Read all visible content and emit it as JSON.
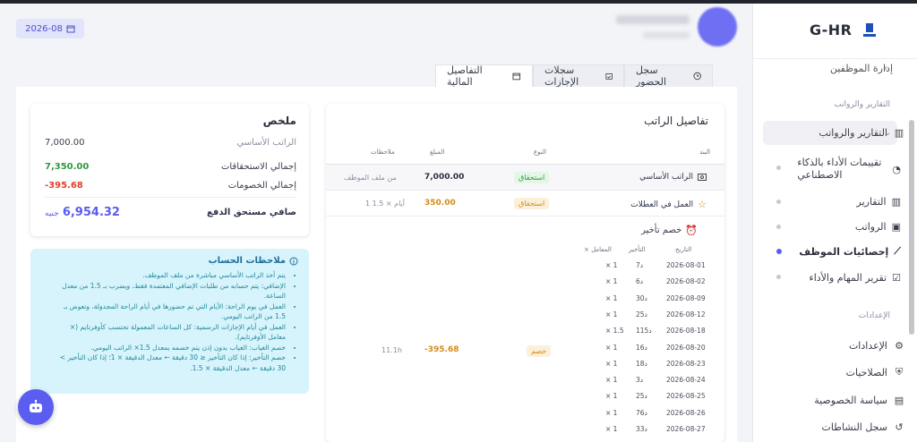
{
  "header": {
    "date_chip": "2026-08"
  },
  "brand": {
    "name": "G-HR"
  },
  "tabs": [
    {
      "label": "سجل الحضور",
      "icon": "clock-icon"
    },
    {
      "label": "سجلات الإجازات",
      "icon": "calendar-icon"
    },
    {
      "label": "التفاصيل المالية",
      "icon": "wallet-icon",
      "active": true
    }
  ],
  "sidebar": {
    "partial_top": "إدارة الموظفين",
    "section_reports": "التقارير والرواتب",
    "group_reports": "التقارير والرواتب",
    "sub_items": [
      "تقييمات الأداء بالذكاء الاصطناعي",
      "التقارير",
      "الرواتب",
      "إحصائيات الموظف",
      "تقرير المهام والأداء"
    ],
    "section_settings": "الإعدادات",
    "settings_items": [
      "الإعدادات",
      "الصلاحيات",
      "سياسة الخصوصية",
      "سجل النشاطات"
    ]
  },
  "summary": {
    "title": "ملخص",
    "base_label": "الراتب الأساسي",
    "base_value": "7,000.00",
    "earnings_label": "إجمالي الاستحقاقات",
    "earnings_value": "7,350.00",
    "deductions_label": "إجمالي الخصومات",
    "deductions_value": "-395.68",
    "net_label": "صافي مستحق الدفع",
    "net_value": "6,954.32",
    "currency": "جنيه"
  },
  "notes": {
    "title": "ملاحظات الحساب",
    "items": [
      "يتم أخذ الراتب الأساسي مباشرة من ملف الموظف.",
      "الإضافي: يتم حسابه من طلبات الإضافي المعتمدة فقط، ويضرب بـ 1.5 من معدل الساعة.",
      "العمل في يوم الراحة: الأيام التي تم حضورها في أيام الراحة المجدولة، وتعوض بـ 1.5 من الراتب اليومي.",
      "العمل في أيام الإجازات الرسمية: كل الساعات المعمولة تحتسب كأوفرتايم (× معامل الأوفرتايم).",
      "خصم الغياب: الغياب بدون إذن يتم خصمه بمعدل 1.5× الراتب اليومي.",
      "خصم التأخير: إذا كان التأخير ≤ 30 دقيقة ← معدل الدقيقة × 1؛ إذا كان التأخير > 30 دقيقة ← معدل الدقيقة × 1.5."
    ]
  },
  "details": {
    "title": "تفاصيل الراتب",
    "columns": {
      "item": "البند",
      "type": "النوع",
      "amount": "المبلغ",
      "notes": "ملاحظات"
    },
    "rows": [
      {
        "item": "الراتب الأساسي",
        "type": "استحقاق",
        "amount": "7,000.00",
        "note": "من ملف الموظف"
      },
      {
        "item": "العمل في العطلات",
        "type": "استحقاق",
        "amount": "350.00",
        "note": "1 أيام × 1.5"
      }
    ],
    "late": {
      "title": "خصم تأخير",
      "type": "خصم",
      "amount": "-395.68",
      "note": "11.1h",
      "columns": {
        "date": "التاريخ",
        "delay": "التأخير",
        "factor": "× المعامل"
      },
      "rows": [
        {
          "date": "2026-08-01",
          "delay": "7د",
          "factor": "× 1"
        },
        {
          "date": "2026-08-02",
          "delay": "6د",
          "factor": "× 1"
        },
        {
          "date": "2026-08-09",
          "delay": "30د",
          "factor": "× 1"
        },
        {
          "date": "2026-08-12",
          "delay": "25د",
          "factor": "× 1"
        },
        {
          "date": "2026-08-18",
          "delay": "115د",
          "factor": "× 1.5"
        },
        {
          "date": "2026-08-20",
          "delay": "16د",
          "factor": "× 1"
        },
        {
          "date": "2026-08-23",
          "delay": "18د",
          "factor": "× 1"
        },
        {
          "date": "2026-08-24",
          "delay": "3د",
          "factor": "× 1"
        },
        {
          "date": "2026-08-25",
          "delay": "25د",
          "factor": "× 1"
        },
        {
          "date": "2026-08-26",
          "delay": "76د",
          "factor": "× 1"
        },
        {
          "date": "2026-08-27",
          "delay": "33د",
          "factor": "× 1"
        }
      ]
    }
  },
  "colors": {
    "accent": "#5b5cf0",
    "earnings": "#2e9a3c",
    "deductions": "#e0412b",
    "amount_orange": "#d38c16"
  }
}
